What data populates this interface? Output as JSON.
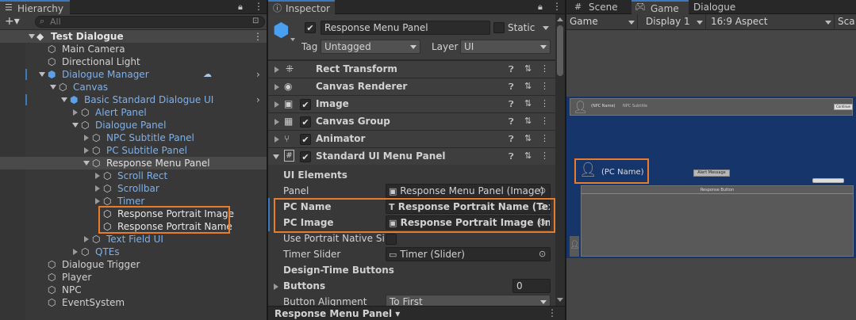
{
  "hierarchy": {
    "tab_label": "Hierarchy",
    "search_placeholder": "All",
    "add_label": "+▾",
    "items": [
      {
        "label": "Test Dialogue"
      },
      {
        "label": "Main Camera"
      },
      {
        "label": "Directional Light"
      },
      {
        "label": "Dialogue Manager"
      },
      {
        "label": "Canvas"
      },
      {
        "label": "Basic Standard Dialogue UI"
      },
      {
        "label": "Alert Panel"
      },
      {
        "label": "Dialogue Panel"
      },
      {
        "label": "NPC Subtitle Panel"
      },
      {
        "label": "PC Subtitle Panel"
      },
      {
        "label": "Response Menu Panel"
      },
      {
        "label": "Scroll Rect"
      },
      {
        "label": "Scrollbar"
      },
      {
        "label": "Timer"
      },
      {
        "label": "Response Portrait Image"
      },
      {
        "label": "Response Portrait Name"
      },
      {
        "label": "Text Field UI"
      },
      {
        "label": "QTEs"
      },
      {
        "label": "Dialogue Trigger"
      },
      {
        "label": "Player"
      },
      {
        "label": "NPC"
      },
      {
        "label": "EventSystem"
      }
    ]
  },
  "inspector": {
    "tab_label": "Inspector",
    "object_name": "Response Menu Panel",
    "static_label": "Static",
    "tag_label": "Tag",
    "tag_value": "Untagged",
    "layer_label": "Layer",
    "layer_value": "UI",
    "components": [
      {
        "label": "Rect Transform"
      },
      {
        "label": "Canvas Renderer"
      },
      {
        "label": "Image"
      },
      {
        "label": "Canvas Group"
      },
      {
        "label": "Animator"
      },
      {
        "label": "Standard UI Menu Panel"
      }
    ],
    "section_ui_elements": "UI Elements",
    "fields": {
      "panel_label": "Panel",
      "panel_value": "Response Menu Panel (Image)",
      "pc_name_label": "PC Name",
      "pc_name_value": "Response Portrait Name (Tex",
      "pc_image_label": "PC Image",
      "pc_image_value": "Response Portrait Image (Ima",
      "use_portrait_label": "Use Portrait Native Size",
      "timer_label": "Timer Slider",
      "timer_value": "Timer (Slider)",
      "design_time_label": "Design-Time Buttons",
      "buttons_label": "Buttons",
      "buttons_value": "0",
      "alignment_label": "Button Alignment",
      "alignment_value": "To First"
    },
    "footer_label": "Response Menu Panel ▾"
  },
  "game": {
    "tabs": [
      "Scene",
      "Game",
      "Dialogue"
    ],
    "display_mode": "Game",
    "display": "Display 1",
    "aspect": "16:9 Aspect",
    "scale": "Sca",
    "npc_name": "(NPC Name)",
    "npc_subtitle": "NPC Subtitle",
    "continue": "Continue",
    "pc_name": "(PC Name)",
    "alert": "Alert Message",
    "response_button": "Response Button"
  },
  "colors": {
    "accent": "#e87c2b",
    "selection": "#2c5d87",
    "link_blue": "#7ab1f0"
  }
}
